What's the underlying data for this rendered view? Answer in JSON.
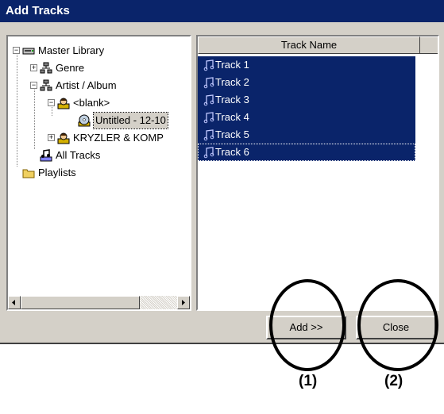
{
  "window": {
    "title": "Add Tracks",
    "title_bg": "#0a246a"
  },
  "tree": {
    "nodes": [
      {
        "label": "Master Library",
        "icon": "library-drive-icon",
        "expander": "−"
      },
      {
        "label": "Genre",
        "icon": "tree-hierarchy-icon",
        "expander": "+"
      },
      {
        "label": "Artist / Album",
        "icon": "tree-hierarchy-icon",
        "expander": "−"
      },
      {
        "label": "<blank>",
        "icon": "artist-person-icon",
        "expander": "−"
      },
      {
        "label": "Untitled - 12-10",
        "icon": "album-cd-icon",
        "expander": ""
      },
      {
        "label": "KRYZLER & KOMP",
        "icon": "artist-person-icon",
        "expander": "+"
      },
      {
        "label": "All Tracks",
        "icon": "all-tracks-icon",
        "expander": ""
      },
      {
        "label": "Playlists",
        "icon": "folder-icon",
        "expander": ""
      }
    ],
    "selected_index": 4
  },
  "track_list": {
    "column_header": "Track Name",
    "items": [
      "Track 1",
      "Track 2",
      "Track 3",
      "Track 4",
      "Track 5",
      "Track 6"
    ],
    "item_icon": "music-note-icon",
    "selection_color": "#0a246a"
  },
  "buttons": {
    "add_label": "Add >>",
    "close_label": "Close"
  },
  "callouts": {
    "one": "(1)",
    "two": "(2)"
  }
}
